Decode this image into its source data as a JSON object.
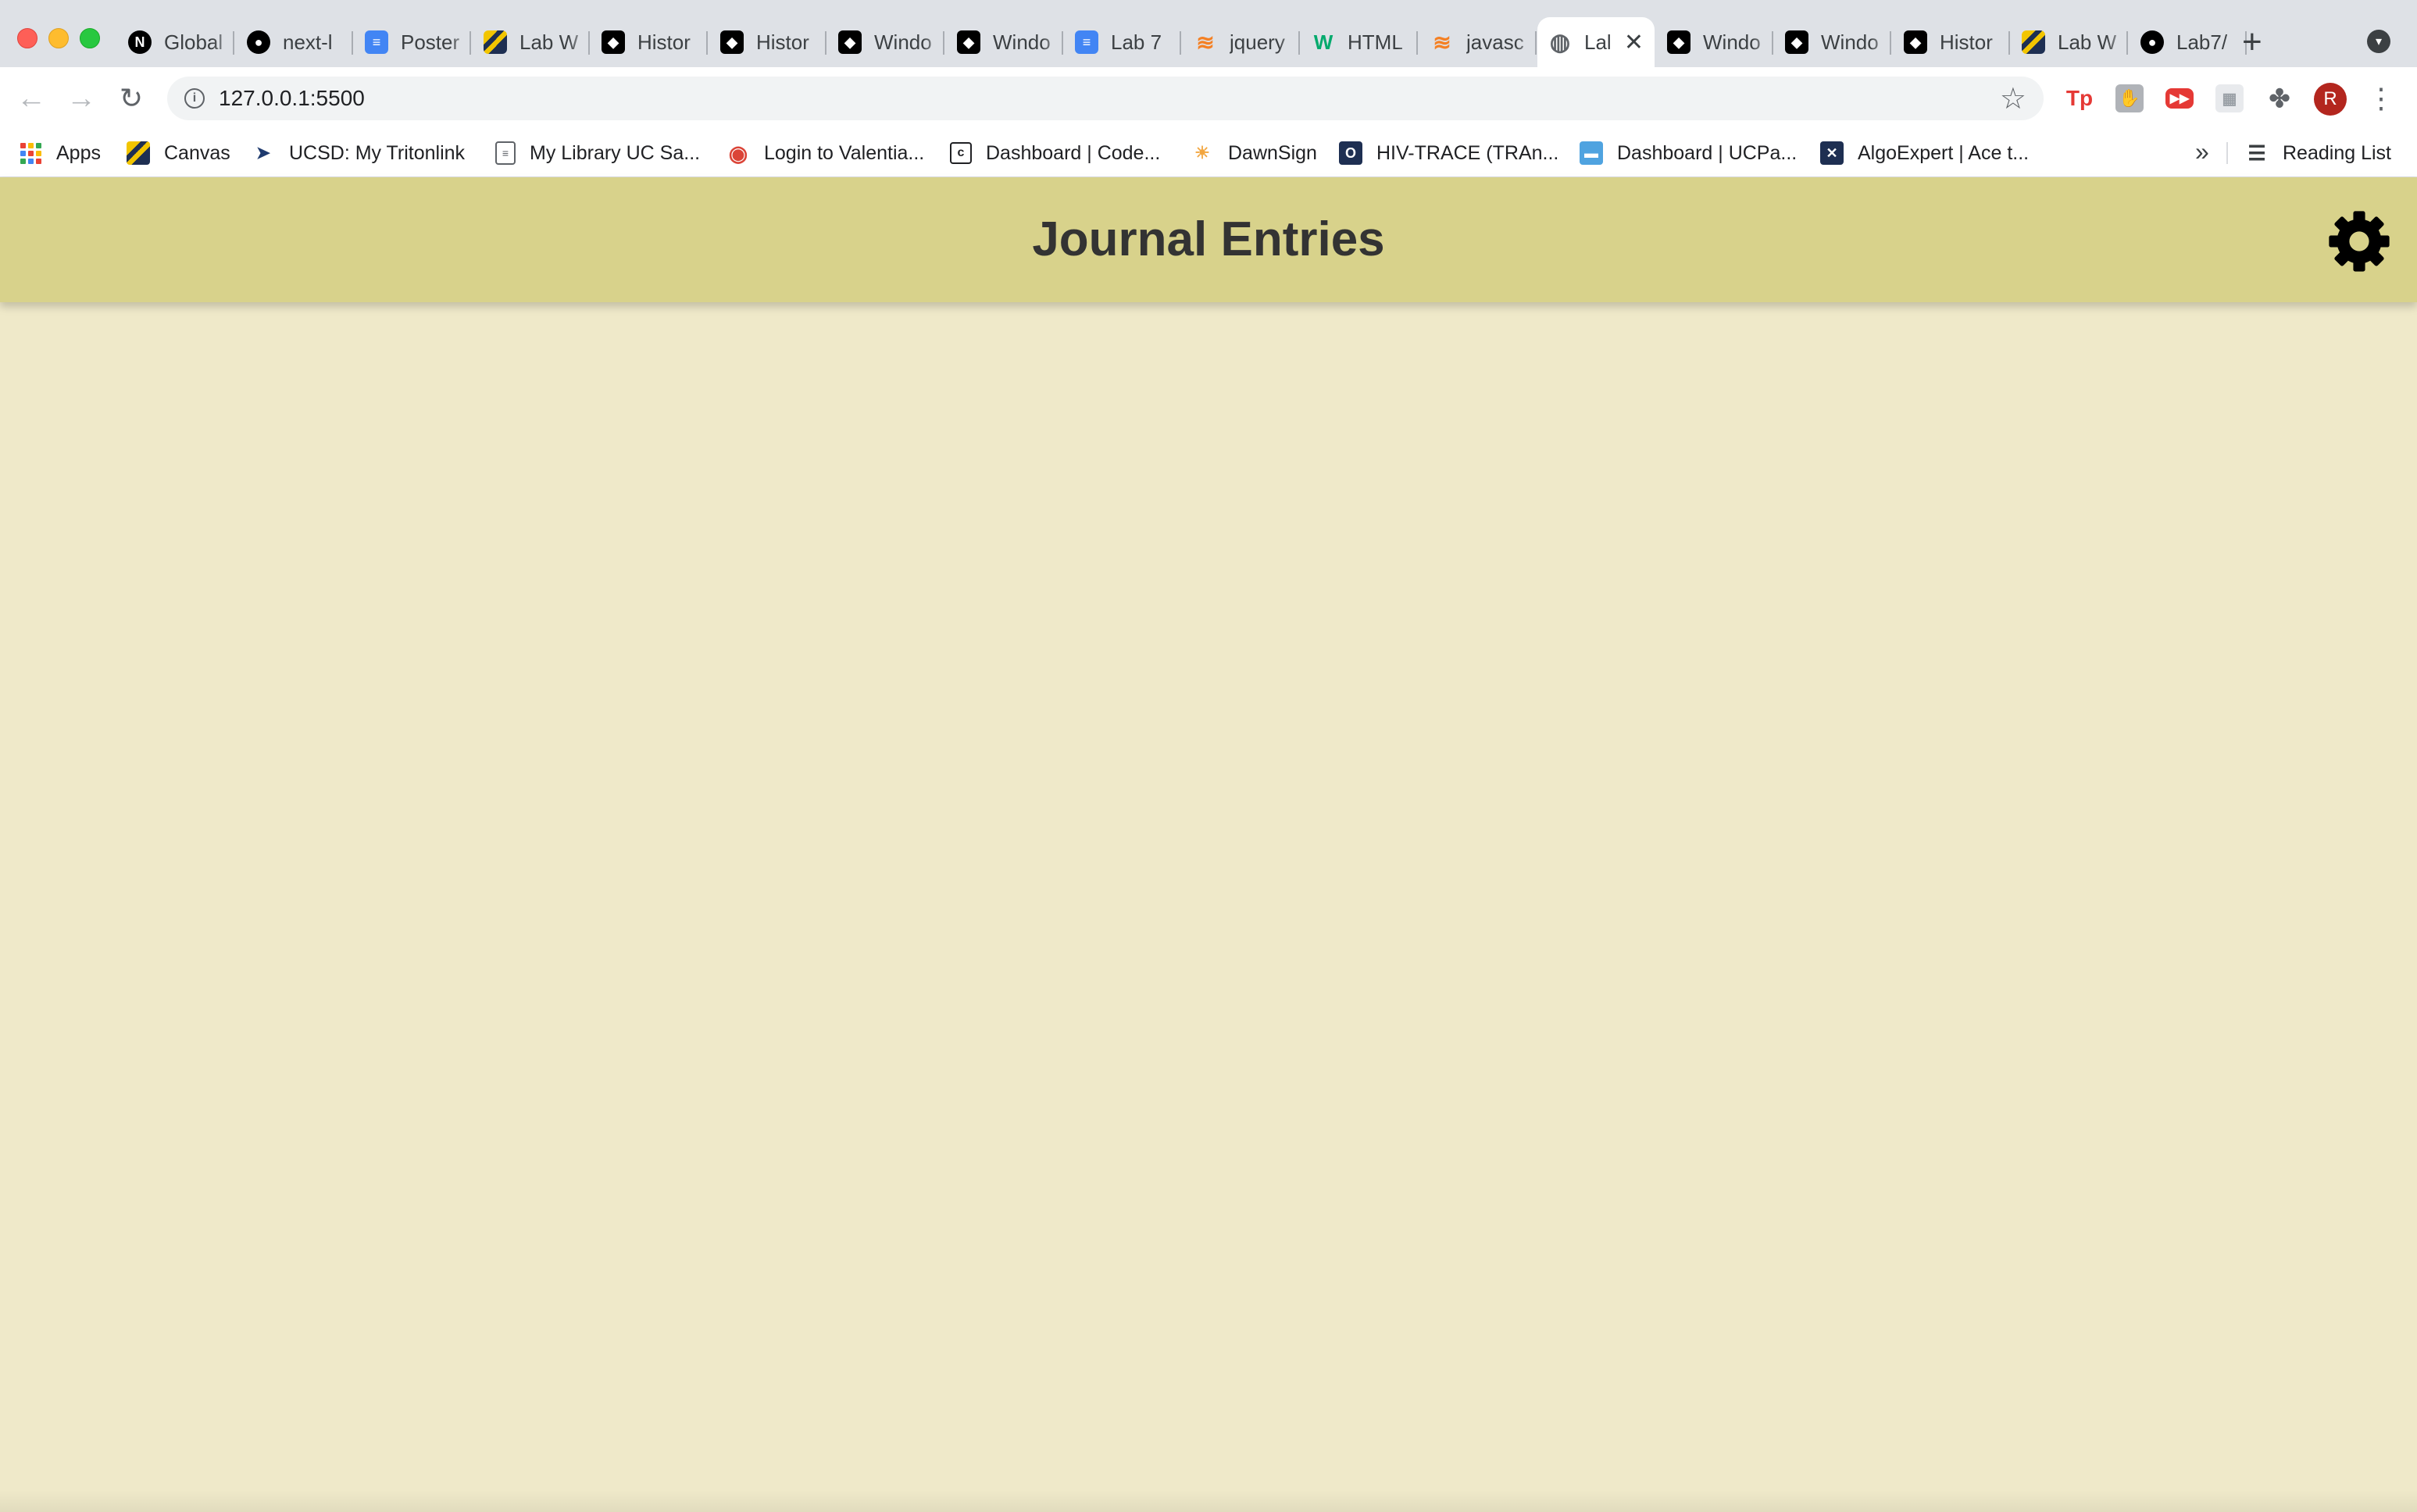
{
  "browser": {
    "tabs": [
      {
        "title": "Global",
        "favicon": "next-icon",
        "active": false
      },
      {
        "title": "next-l",
        "favicon": "github-icon",
        "active": false
      },
      {
        "title": "Poster",
        "favicon": "docs-icon",
        "active": false
      },
      {
        "title": "Lab W",
        "favicon": "lab-icon",
        "active": false
      },
      {
        "title": "Histor",
        "favicon": "notion-icon",
        "active": false
      },
      {
        "title": "Histor",
        "favicon": "notion-icon",
        "active": false
      },
      {
        "title": "Windo",
        "favicon": "notion-icon",
        "active": false
      },
      {
        "title": "Windo",
        "favicon": "notion-icon",
        "active": false
      },
      {
        "title": "Lab 7",
        "favicon": "docs-icon",
        "active": false
      },
      {
        "title": "jquery",
        "favicon": "stackoverflow-icon",
        "active": false
      },
      {
        "title": "HTML",
        "favicon": "w3schools-icon",
        "active": false
      },
      {
        "title": "javasc",
        "favicon": "stackoverflow-icon",
        "active": false
      },
      {
        "title": "Lal",
        "favicon": "globe-icon",
        "active": true
      },
      {
        "title": "Windo",
        "favicon": "notion-icon",
        "active": false
      },
      {
        "title": "Windo",
        "favicon": "notion-icon",
        "active": false
      },
      {
        "title": "Histor",
        "favicon": "notion-icon",
        "active": false
      },
      {
        "title": "Lab W",
        "favicon": "lab-icon",
        "active": false
      },
      {
        "title": "Lab7/",
        "favicon": "github-icon",
        "active": false
      }
    ],
    "new_tab_label": "+",
    "url": "127.0.0.1:5500",
    "avatar_letter": "R",
    "extensions": {
      "tp": "Tp"
    },
    "bookmarks": [
      {
        "label": "Apps",
        "icon": "apps-grid-icon"
      },
      {
        "label": "Canvas",
        "icon": "canvas-icon"
      },
      {
        "label": "UCSD: My Tritonlink",
        "icon": "triton-icon"
      },
      {
        "label": "My Library UC Sa...",
        "icon": "document-icon"
      },
      {
        "label": "Login to Valentia...",
        "icon": "chrome-icon"
      },
      {
        "label": "Dashboard | Code...",
        "icon": "code-icon"
      },
      {
        "label": "DawnSign",
        "icon": "dawnsign-icon"
      },
      {
        "label": "HIV-TRACE (TRAn...",
        "icon": "hivtrace-icon"
      },
      {
        "label": "Dashboard | UCPa...",
        "icon": "ucpath-icon"
      },
      {
        "label": "AlgoExpert | Ace t...",
        "icon": "algoexpert-icon"
      }
    ],
    "reading_list_label": "Reading List"
  },
  "page": {
    "title": "Journal Entries",
    "colors": {
      "header": "#d8d28b",
      "background": "#efe9c9",
      "title_text": "#333333"
    }
  }
}
